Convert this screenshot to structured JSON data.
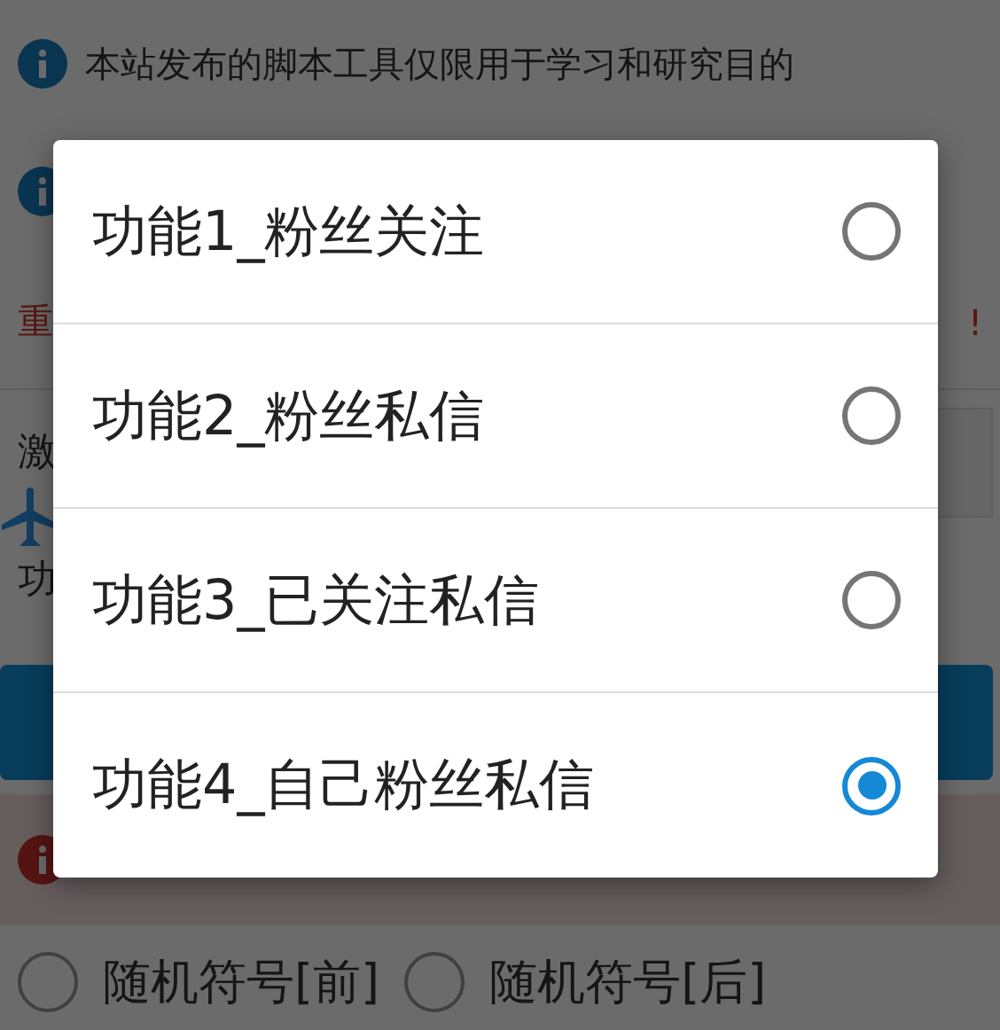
{
  "notice": {
    "text": "本站发布的脚本工具仅限用于学习和研究目的"
  },
  "warning_line": {
    "start": "重",
    "end": "!"
  },
  "activation_label": "激",
  "feature_label": "功",
  "random_symbol_options": [
    {
      "label": "随机符号[前]",
      "selected": false
    },
    {
      "label": "随机符号[后]",
      "selected": false
    }
  ],
  "dialog": {
    "options": [
      {
        "label": "功能1_粉丝关注",
        "selected": false
      },
      {
        "label": "功能2_粉丝私信",
        "selected": false
      },
      {
        "label": "功能3_已关注私信",
        "selected": false
      },
      {
        "label": "功能4_自己粉丝私信",
        "selected": true
      }
    ]
  }
}
